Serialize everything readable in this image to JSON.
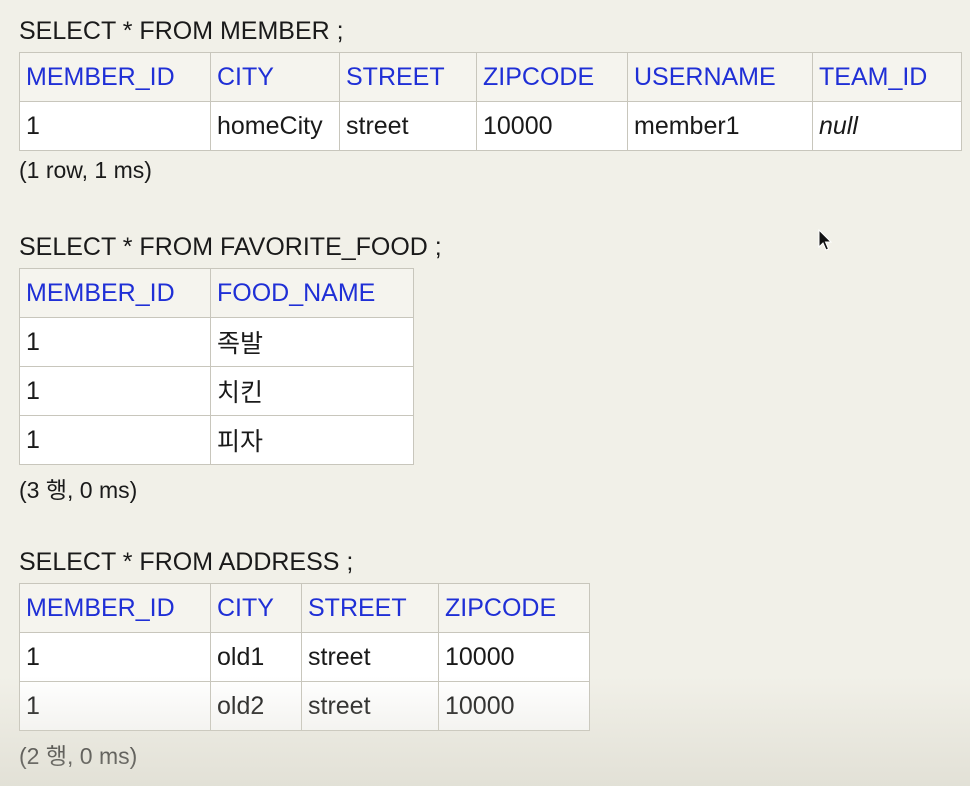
{
  "queries": [
    {
      "sql": "SELECT * FROM MEMBER ;",
      "columns": [
        "MEMBER_ID",
        "CITY",
        "STREET",
        "ZIPCODE",
        "USERNAME",
        "TEAM_ID"
      ],
      "rows": [
        [
          "1",
          "homeCity",
          "street",
          "10000",
          "member1",
          "null"
        ]
      ],
      "info": "(1 row, 1 ms)"
    },
    {
      "sql": "SELECT * FROM FAVORITE_FOOD ;",
      "columns": [
        "MEMBER_ID",
        "FOOD_NAME"
      ],
      "rows": [
        [
          "1",
          "족발"
        ],
        [
          "1",
          "치킨"
        ],
        [
          "1",
          "피자"
        ]
      ],
      "info": "(3 행, 0 ms)"
    },
    {
      "sql": "SELECT * FROM ADDRESS ;",
      "columns": [
        "MEMBER_ID",
        "CITY",
        "STREET",
        "ZIPCODE"
      ],
      "rows": [
        [
          "1",
          "old1",
          "street",
          "10000"
        ],
        [
          "1",
          "old2",
          "street",
          "10000"
        ]
      ],
      "info": "(2 행, 0 ms)"
    }
  ],
  "colors": {
    "header_text": "#1f2fd6",
    "background": "#f1f0e8",
    "cell_background": "#ffffff"
  },
  "icons": {
    "cursor": "mouse-pointer-icon"
  }
}
